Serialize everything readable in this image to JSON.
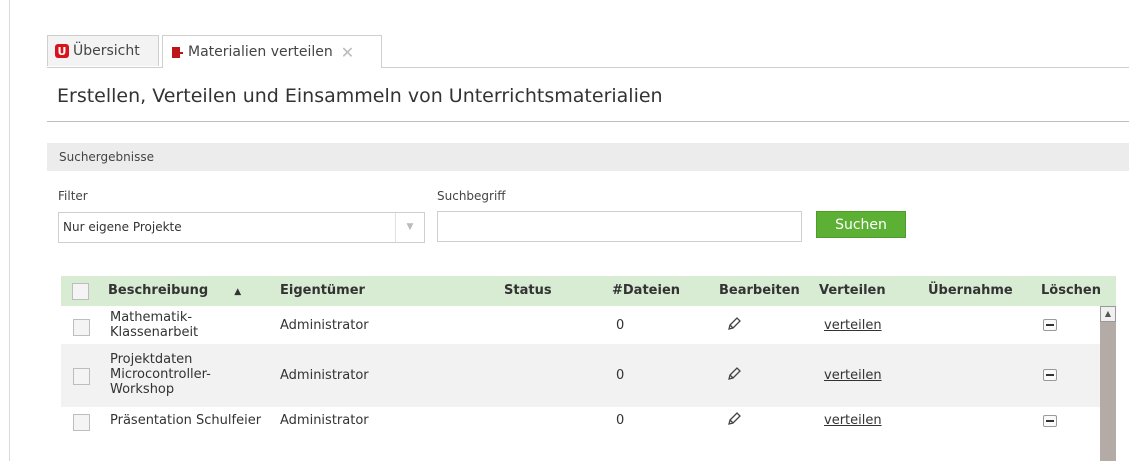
{
  "tabs": [
    {
      "label": "Übersicht",
      "icon": "app-logo-icon"
    },
    {
      "label": "Materialien verteilen",
      "icon": "book-icon",
      "closable": true
    }
  ],
  "page_title": "Erstellen, Verteilen und Einsammeln von Unterrichtsmaterialien",
  "section_title": "Suchergebnisse",
  "filter": {
    "label": "Filter",
    "value": "Nur eigene Projekte"
  },
  "search": {
    "label": "Suchbegriff",
    "value": "",
    "button_label": "Suchen"
  },
  "table": {
    "headers": {
      "description": "Beschreibung",
      "owner": "Eigentümer",
      "status": "Status",
      "files": "#Dateien",
      "edit": "Bearbeiten",
      "distribute": "Verteilen",
      "takeover": "Übernahme",
      "delete": "Löschen"
    },
    "rows": [
      {
        "description": "Mathematik-\nKlassenarbeit",
        "owner": "Administrator",
        "status": "",
        "files": "0",
        "distribute": "verteilen"
      },
      {
        "description": "Projektdaten\nMicrocontroller-\nWorkshop",
        "owner": "Administrator",
        "status": "",
        "files": "0",
        "distribute": "verteilen"
      },
      {
        "description": "Präsentation Schulfeier",
        "owner": "Administrator",
        "status": "",
        "files": "0",
        "distribute": "verteilen"
      }
    ]
  },
  "colors": {
    "accent_green": "#5cb134",
    "header_green": "#d7ecd2",
    "logo_red": "#d8131c"
  }
}
